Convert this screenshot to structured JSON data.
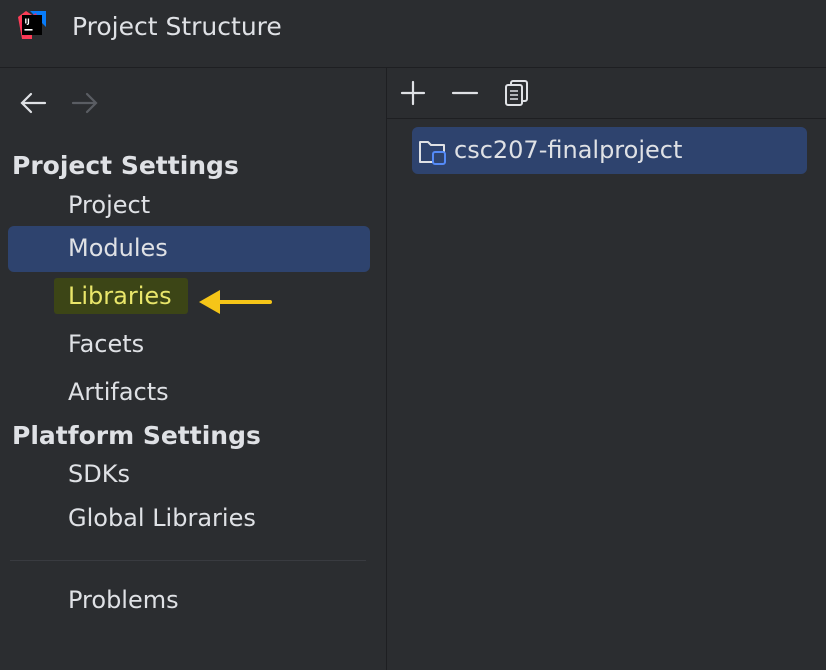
{
  "window": {
    "title": "Project Structure",
    "app_icon": "intellij-logo-icon"
  },
  "sidebar": {
    "back_icon": "arrow-left-icon",
    "forward_icon": "arrow-right-icon",
    "sections": [
      {
        "title": "Project Settings",
        "items": [
          {
            "label": "Project"
          },
          {
            "label": "Modules",
            "selected": true
          },
          {
            "label": "Libraries",
            "highlighted": true
          },
          {
            "label": "Facets"
          },
          {
            "label": "Artifacts"
          }
        ]
      },
      {
        "title": "Platform Settings",
        "items": [
          {
            "label": "SDKs"
          },
          {
            "label": "Global Libraries"
          }
        ]
      }
    ],
    "problems_label": "Problems"
  },
  "toolbar": {
    "add_icon": "plus-icon",
    "remove_icon": "minus-icon",
    "copy_icon": "copy-icon"
  },
  "tree": {
    "items": [
      {
        "label": "csc207-finalproject",
        "icon": "module-folder-icon",
        "selected": true
      }
    ]
  },
  "colors": {
    "background": "#2b2d30",
    "selection": "#2e436e",
    "annotation_arrow": "#f5c518",
    "highlight_text": "#e9e66a"
  }
}
